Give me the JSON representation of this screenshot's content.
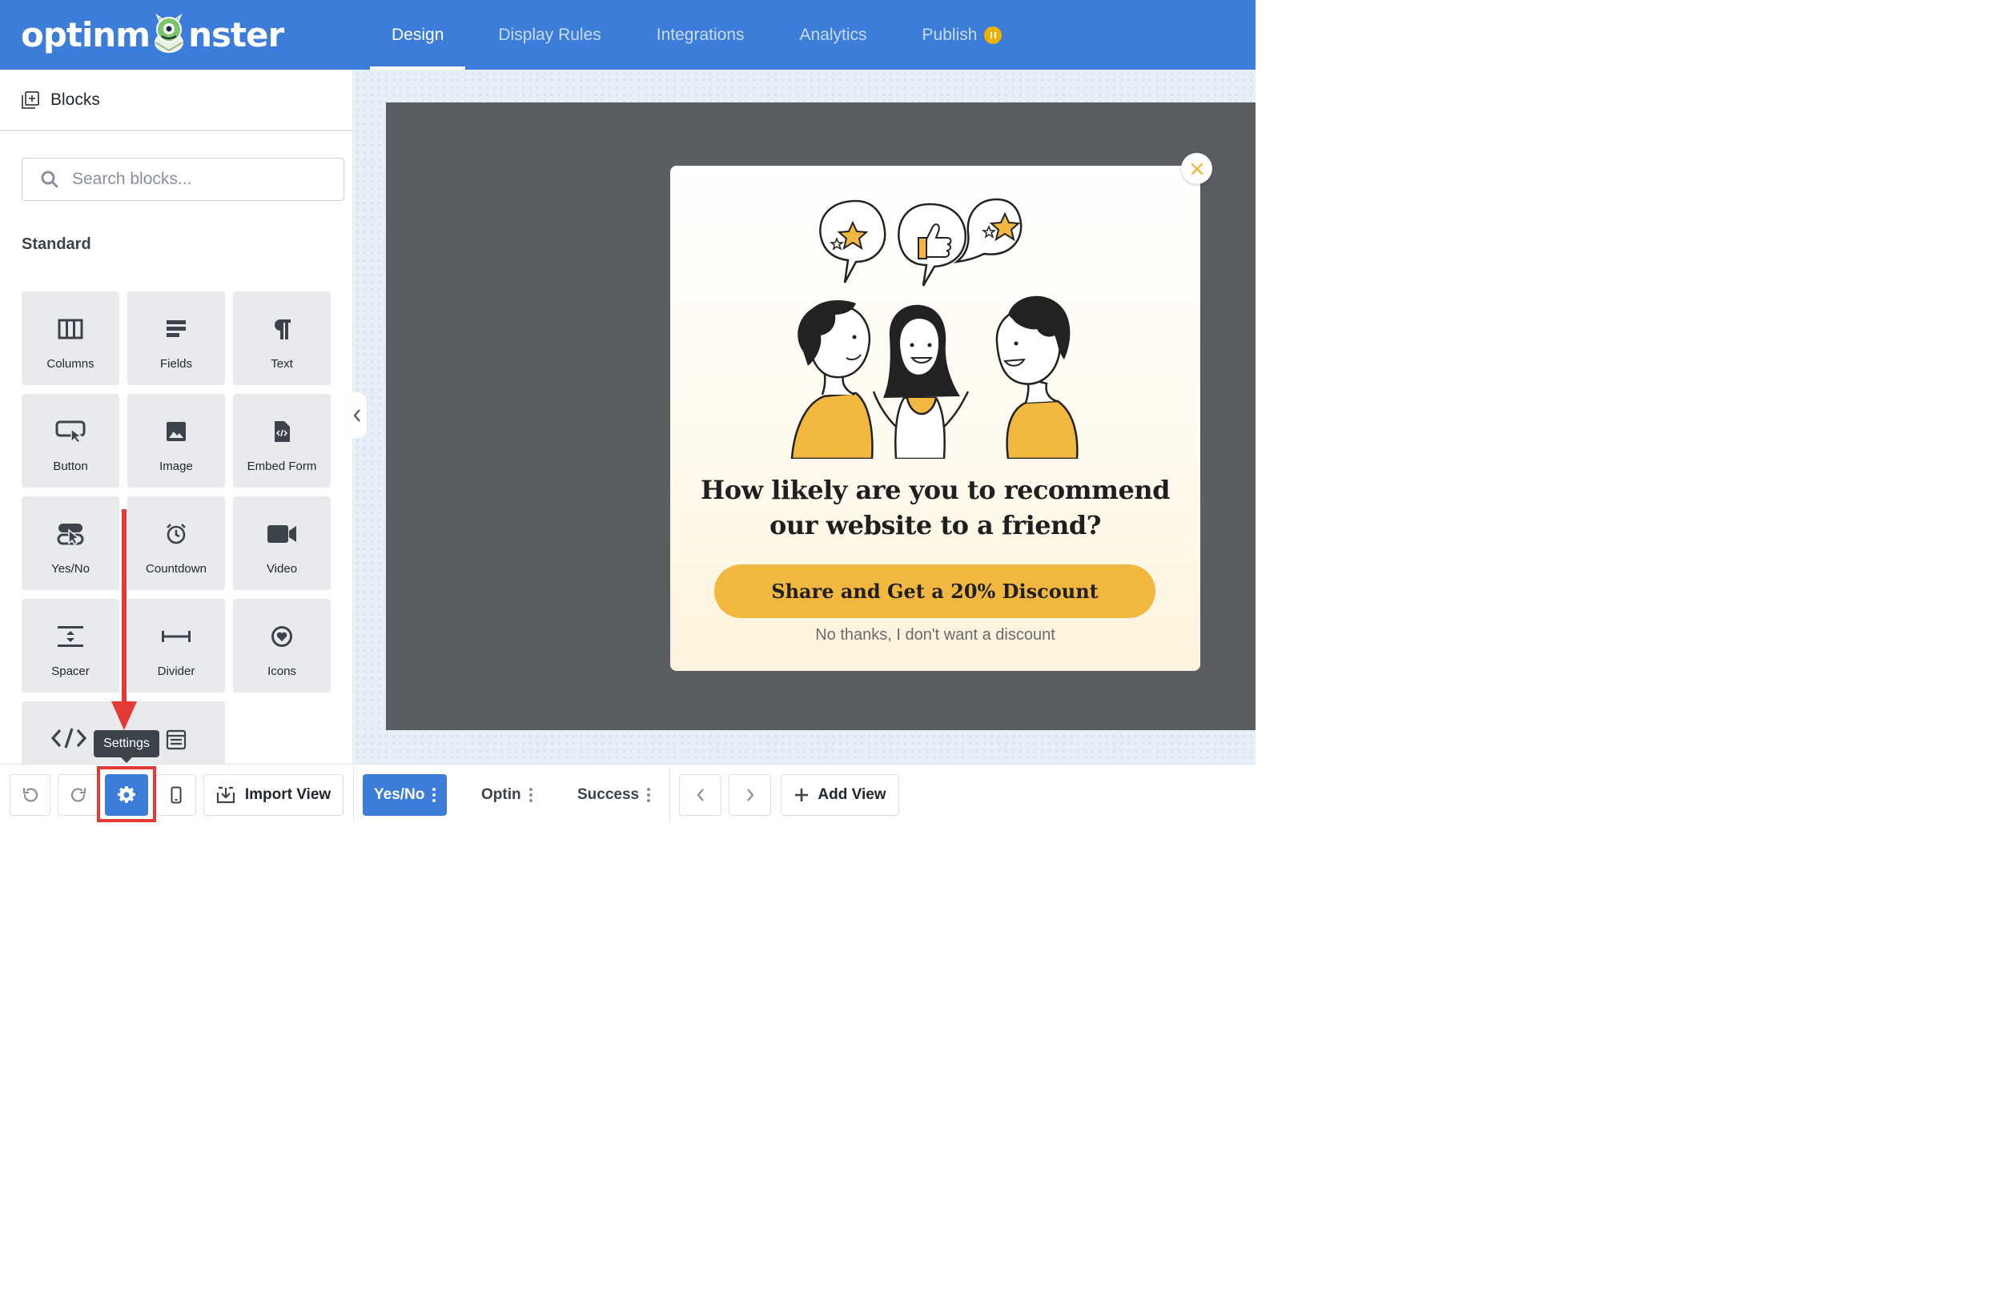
{
  "app": {
    "logo_text_left": "optinm",
    "logo_text_right": "nster"
  },
  "nav": {
    "tabs": [
      {
        "label": "Design",
        "active": true
      },
      {
        "label": "Display Rules",
        "active": false
      },
      {
        "label": "Integrations",
        "active": false
      },
      {
        "label": "Analytics",
        "active": false
      },
      {
        "label": "Publish",
        "active": false,
        "status_icon": "pause-icon",
        "status_color": "#f0b400"
      }
    ]
  },
  "sidebar": {
    "header_title": "Blocks",
    "header_icon": "add-block-icon",
    "search_placeholder": "Search blocks...",
    "section_title": "Standard",
    "blocks": [
      {
        "label": "Columns",
        "icon": "columns-icon"
      },
      {
        "label": "Fields",
        "icon": "fields-icon"
      },
      {
        "label": "Text",
        "icon": "paragraph-icon"
      },
      {
        "label": "Button",
        "icon": "button-cursor-icon"
      },
      {
        "label": "Image",
        "icon": "image-icon"
      },
      {
        "label": "Embed Form",
        "icon": "embed-code-file-icon"
      },
      {
        "label": "Yes/No",
        "icon": "yes-no-toggle-icon"
      },
      {
        "label": "Countdown",
        "icon": "alarm-clock-icon"
      },
      {
        "label": "Video",
        "icon": "video-camera-icon"
      },
      {
        "label": "Spacer",
        "icon": "spacer-icon"
      },
      {
        "label": "Divider",
        "icon": "divider-icon"
      },
      {
        "label": "Icons",
        "icon": "heart-circle-icon"
      },
      {
        "label": "",
        "icon": "html-code-icon"
      }
    ]
  },
  "toolbar": {
    "settings_tooltip": "Settings",
    "import_view_label": "Import View",
    "views": [
      {
        "label": "Yes/No",
        "active": true
      },
      {
        "label": "Optin",
        "active": false
      },
      {
        "label": "Success",
        "active": false
      }
    ],
    "add_view_label": "Add View"
  },
  "popup": {
    "heading": "How likely are you to recommend our website to a friend?",
    "cta_label": "Share and Get a 20% Discount",
    "decline_label": "No thanks, I don't want a discount"
  },
  "colors": {
    "brand_blue": "#3b7dd8",
    "cta_yellow": "#f2b73f",
    "annotation_red": "#e53935",
    "preview_overlay": "#5a5e62"
  }
}
